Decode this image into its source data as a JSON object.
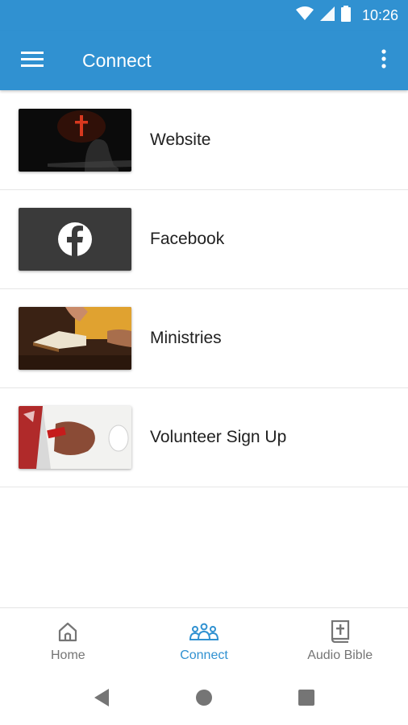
{
  "status_bar": {
    "time": "10:26",
    "icons": [
      "wifi-icon",
      "cell-signal-icon",
      "battery-icon"
    ]
  },
  "app_bar": {
    "title": "Connect",
    "menu_icon": "hamburger-menu-icon",
    "overflow_icon": "more-vert-icon",
    "color": "#3091d1"
  },
  "connect_items": [
    {
      "label": "Website",
      "thumbnail": "cross-silhouette-image"
    },
    {
      "label": "Facebook",
      "thumbnail": "facebook-logo-image"
    },
    {
      "label": "Ministries",
      "thumbnail": "open-bible-image"
    },
    {
      "label": "Volunteer Sign Up",
      "thumbnail": "signing-paper-image"
    }
  ],
  "bottom_nav": {
    "items": [
      {
        "label": "Home",
        "icon": "home-icon",
        "active": false
      },
      {
        "label": "Connect",
        "icon": "people-group-icon",
        "active": true
      },
      {
        "label": "Audio Bible",
        "icon": "bible-icon",
        "active": false
      }
    ],
    "active_color": "#3091d1",
    "inactive_color": "#757575"
  },
  "system_nav": [
    "back-icon",
    "home-circle-icon",
    "recents-icon"
  ]
}
